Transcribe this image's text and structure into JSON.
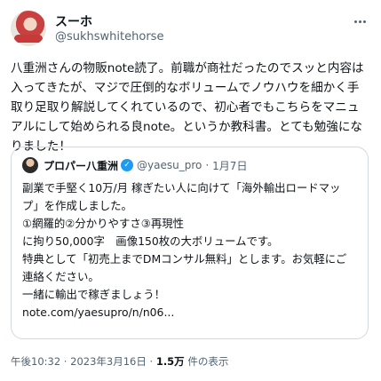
{
  "author": {
    "name": "スーホ",
    "handle": "@sukhswhitehorse"
  },
  "tweet_text": "八重洲さんの物販note読了。前職が商社だったのでスッと内容は入ってきたが、マジで圧倒的なボリュームでノウハウを細かく手取り足取り解説してくれているので、初心者でもこちらをマニュアルにして始められる良note。というか教科書。とても勉強になりました！",
  "quote": {
    "name": "プロパー八重洲",
    "handle": "@yaesu_pro",
    "separator": "·",
    "date": "1月7日",
    "text": "副業で手堅く10万/月 稼ぎたい人に向けて「海外輸出ロードマップ」を作成しました。\n①網羅的②分かりやすさ③再現性\nに拘り50,000字　画像150枚の大ボリュームです。\n特典として「初売上までDMコンサル無料」とします。お気軽にご連絡ください。\n一緒に輸出で稼ぎましょう！\nnote.com/yaesupro/n/n06..."
  },
  "meta": {
    "time": "午後10:32",
    "sep1": " · ",
    "date": "2023年3月16日",
    "sep2": " · ",
    "views_count": "1.5万",
    "views_label": " 件の表示"
  },
  "colors": {
    "text": "#0f1419",
    "muted": "#536471",
    "verified": "#1d9bf0",
    "border": "#cfd9de"
  }
}
